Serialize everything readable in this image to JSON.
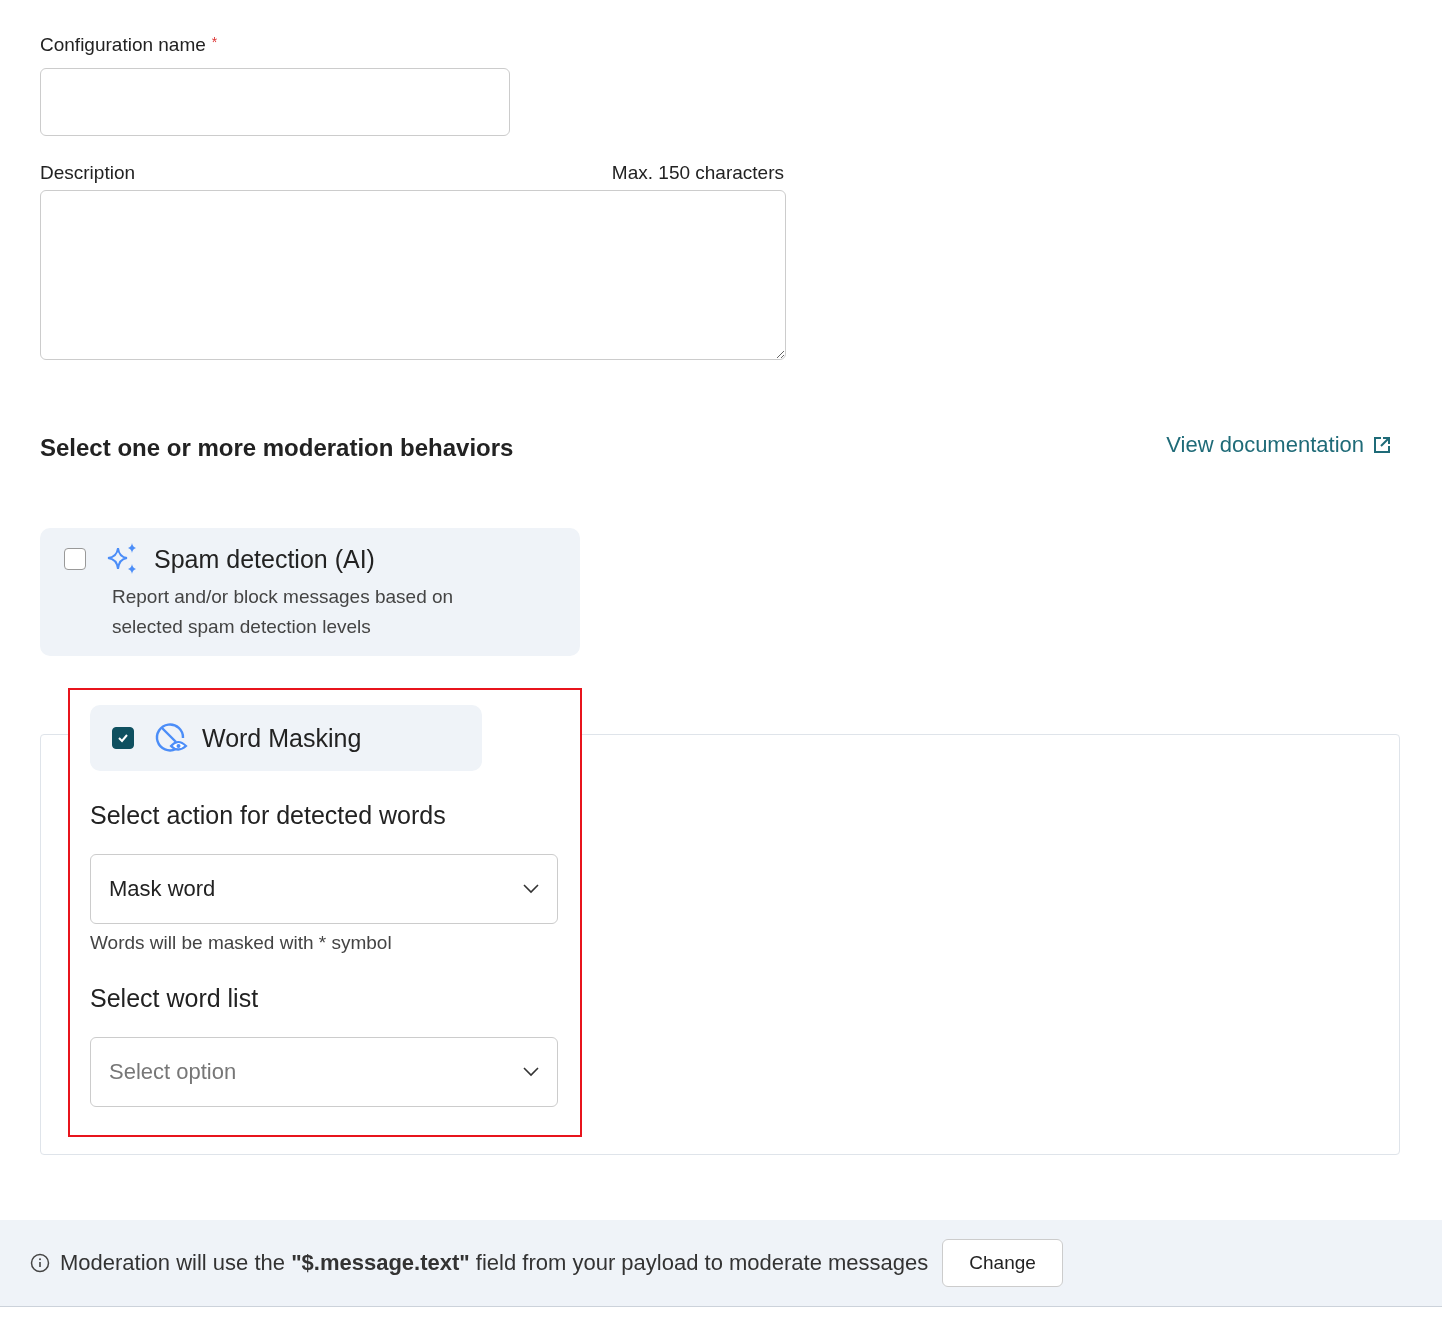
{
  "form": {
    "name_label": "Configuration name",
    "required_mark": "*",
    "description_label": "Description",
    "description_limit": "Max. 150 characters"
  },
  "behaviors": {
    "heading": "Select one or more moderation behaviors",
    "doc_link": "View documentation",
    "spam": {
      "title": "Spam detection (AI)",
      "description": "Report and/or block messages based on selected spam detection levels",
      "checked": false
    },
    "word_masking": {
      "title": "Word Masking",
      "checked": true,
      "highlighted": true,
      "action_label": "Select action for detected words",
      "action_value": "Mask word",
      "action_hint": "Words will be masked with * symbol",
      "list_label": "Select word list",
      "list_placeholder": "Select option"
    }
  },
  "footer": {
    "message": "Moderation will use the **\"$.message.text\"** field from your payload to moderate messages",
    "button": "Change"
  }
}
